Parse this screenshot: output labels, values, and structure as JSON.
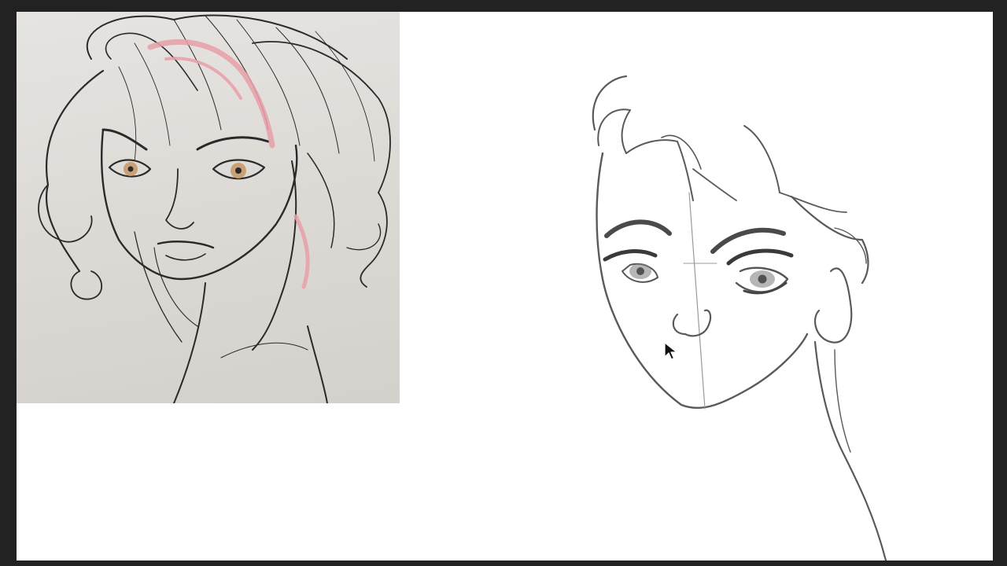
{
  "icons": {
    "cursor": "arrow-pointer-icon"
  },
  "colors": {
    "frame": "#222222",
    "canvas": "#ffffff",
    "paper": "#dedbd7",
    "pencil": "#2a2a2a",
    "sketch_stroke": "#5a5a5a",
    "hair_highlight": "#e8a0a8",
    "eye_iris": "#c89a6a"
  }
}
